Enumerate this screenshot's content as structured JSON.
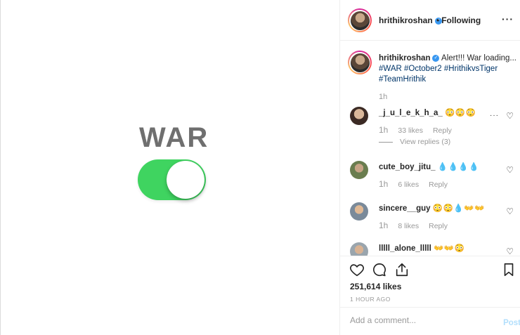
{
  "media": {
    "title": "WAR",
    "toggle_state": "on",
    "toggle_color": "#3fd460"
  },
  "header": {
    "username": "hrithikroshan",
    "verified_icon": "verified-badge-icon",
    "separator": "•",
    "following_label": "Following",
    "more_label": "···"
  },
  "caption": {
    "username": "hrithikroshan",
    "text": "Alert!!! War loading...",
    "hashtags": "#WAR #October2 #HrithikvsTiger #TeamHrithik",
    "time": "1h"
  },
  "comments": [
    {
      "username": "_j_u_l_e_k_h_a_",
      "emoji": "😳😳😳",
      "time": "1h",
      "likes": "33 likes",
      "reply_label": "Reply",
      "view_replies": "View replies (3)",
      "more_label": "···"
    },
    {
      "username": "cute_boy_jitu_",
      "emoji": "💧💧💧💧",
      "time": "1h",
      "likes": "6 likes",
      "reply_label": "Reply"
    },
    {
      "username": "sincere__guy",
      "emoji": "😳😳💧👐👐",
      "time": "1h",
      "likes": "8 likes",
      "reply_label": "Reply"
    },
    {
      "username": "lllll_alone_lllll",
      "emoji": "👐👐😳"
    }
  ],
  "actions": {
    "likes": "251,614 likes",
    "time_ago": "1 HOUR AGO"
  },
  "add_comment": {
    "placeholder": "Add a comment...",
    "post_label": "Post"
  },
  "colors": {
    "accent": "#3897f0",
    "post_disabled": "#b2dffc",
    "toggle": "#3fd460"
  }
}
